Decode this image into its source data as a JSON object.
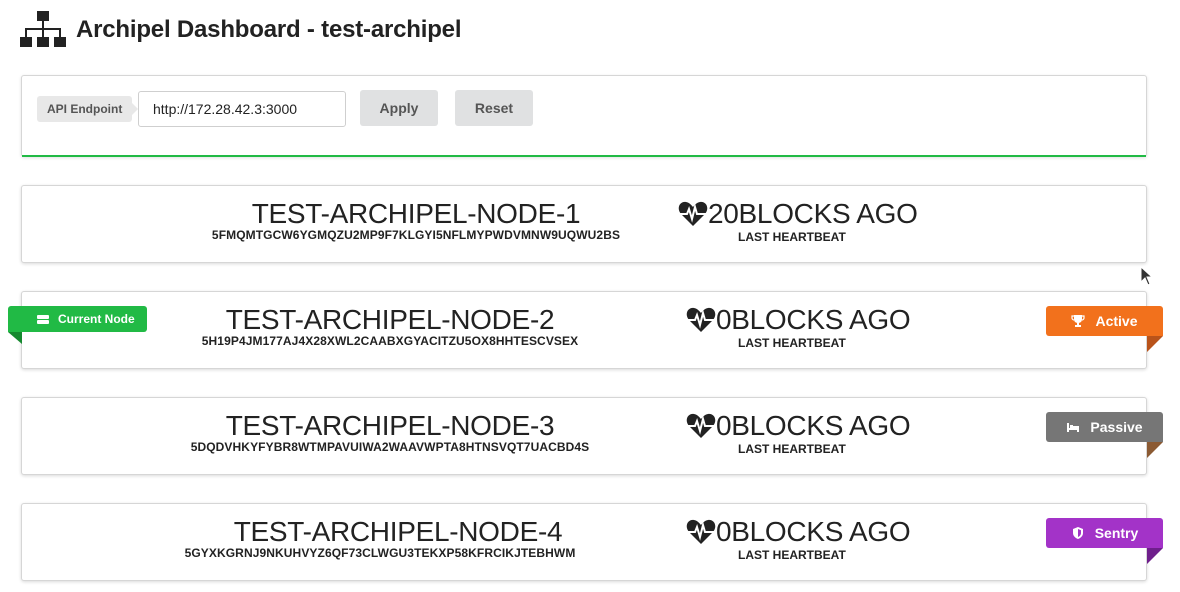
{
  "header": {
    "title": "Archipel Dashboard - test-archipel",
    "logo_icon": "sitemap-icon"
  },
  "api": {
    "label": "API Endpoint",
    "value": "http://172.28.42.3:3000",
    "apply_label": "Apply",
    "reset_label": "Reset",
    "progress_color": "#21ba45"
  },
  "heartbeat_label": "LAST HEARTBEAT",
  "nodes": [
    {
      "name": "TEST-ARCHIPEL-NODE-1",
      "key": "5FMQMTGCW6YGMQZU2MP9F7KLGYI5NFLMYPWDVMNW9UQWU2BS",
      "heartbeat": "20BLOCKS AGO"
    },
    {
      "name": "TEST-ARCHIPEL-NODE-2",
      "key": "5H19P4JM177AJ4X28XWL2CAABXGYACITZU5OX8HHTESCVSEX",
      "heartbeat": "0BLOCKS AGO",
      "current_label": "Current Node",
      "role": "Active",
      "role_color": "#f2711c"
    },
    {
      "name": "TEST-ARCHIPEL-NODE-3",
      "key": "5DQDVHKYFYBR8WTMPAVUIWA2WAAVWPTA8HTNSVQT7UACBD4S",
      "heartbeat": "0BLOCKS AGO",
      "role": "Passive",
      "role_color": "#767676"
    },
    {
      "name": "TEST-ARCHIPEL-NODE-4",
      "key": "5GYXKGRNJ9NKUHVYZ6QF73CLWGU3TEKXP58KFRCIKJTEBHWM",
      "heartbeat": "0BLOCKS AGO",
      "role": "Sentry",
      "role_color": "#a333c8"
    }
  ]
}
